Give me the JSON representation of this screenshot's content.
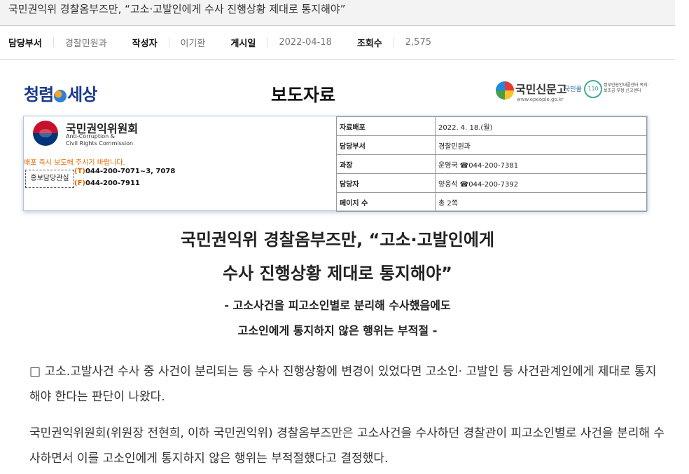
{
  "post": {
    "title": "국민권익위 경찰옴부즈만, “고소·고발인에게 수사 진행상황 제대로 통지해야”",
    "meta": [
      {
        "label": "담당부서",
        "value": "경찰민원과"
      },
      {
        "label": "작성자",
        "value": "이기환"
      },
      {
        "label": "게시일",
        "value": "2022-04-18"
      },
      {
        "label": "조회수",
        "value": "2,575"
      }
    ]
  },
  "press": {
    "left_logo": "청렴",
    "left_logo_tail": "세상",
    "title": "보도자료",
    "right_logo": {
      "name": "국민신문고",
      "url": "www.epeople.go.kr",
      "sub": "국민콜",
      "circle": "110",
      "desc": "정부민원안내콜센터 복지·보조금 부정 신고센터"
    },
    "org_ko": "국민권익위원회",
    "org_en_1": "Anti-Corruption &",
    "org_en_2": "Civil Rights Commission",
    "notice": "배포 즉시 보도해 주시기 바랍니다.",
    "pr_label": "홍보담당관실",
    "phone_t_prefix": "(T)",
    "phone_t": "044-200-7071~3, 7078",
    "phone_f_prefix": "(F)",
    "phone_f": "044-200-7911",
    "info_rows": [
      {
        "key": "자료배포",
        "value": "2022. 4. 18.(월)"
      },
      {
        "key": "담당부서",
        "value": "경찰민원과"
      },
      {
        "key": "과장",
        "value": "운영국 ☎044-200-7381"
      },
      {
        "key": "담당자",
        "value": "양웅석 ☎044-200-7392"
      },
      {
        "key": "페이지 수",
        "value": "총 2쪽"
      }
    ]
  },
  "headline": {
    "line1": "국민권익위 경찰옴부즈만, “고소·고발인에게",
    "line2": "수사 진행상황 제대로 통지해야”",
    "sub1": "- 고소사건을 피고소인별로 분리해 수사했음에도",
    "sub2": "고소인에게 통지하지 않은 행위는 부적절 -"
  },
  "body": {
    "p1": "□ 고소.고발사건 수사 중 사건이 분리되는 등 수사 진행상황에 변경이 있었다면 고소인· 고발인 등 사건관계인에게 제대로 통지해야 한다는 판단이 나왔다.",
    "p2": "국민권익위원회(위원장 전현희, 이하 국민권익위) 경찰옴부즈만은 고소사건을 수사하던 경찰관이 피고소인별로 사건을 분리해 수사하면서 이를 고소인에게 통지하지 않은 행위는 부적절했다고 결정했다."
  }
}
